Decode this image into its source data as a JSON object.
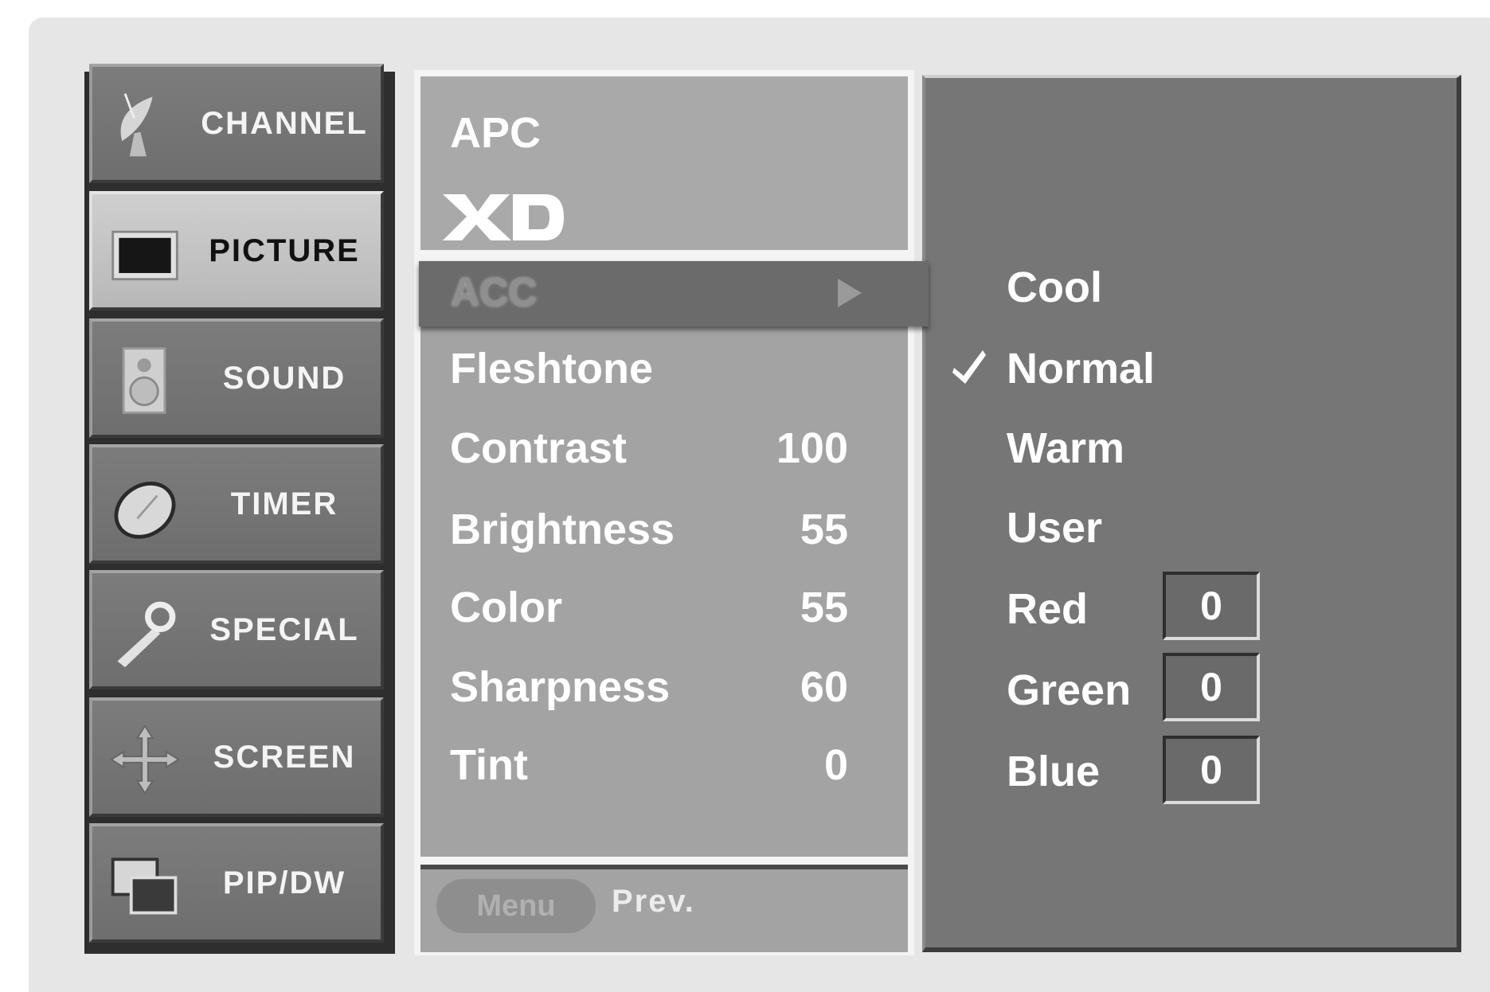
{
  "categories": [
    {
      "label": "CHANNEL",
      "icon": "satellite-dish-icon",
      "active": false
    },
    {
      "label": "PICTURE",
      "icon": "tv-screen-icon",
      "active": true
    },
    {
      "label": "SOUND",
      "icon": "speaker-icon",
      "active": false
    },
    {
      "label": "TIMER",
      "icon": "clock-icon",
      "active": false
    },
    {
      "label": "SPECIAL",
      "icon": "wrench-icon",
      "active": false
    },
    {
      "label": "SCREEN",
      "icon": "move-arrows-icon",
      "active": false
    },
    {
      "label": "PIP/DW",
      "icon": "pip-windows-icon",
      "active": false
    }
  ],
  "picture_menu": {
    "apc_label": "APC",
    "xd_logo": "XD",
    "acc_label": "ACC",
    "options": [
      {
        "name": "Fleshtone",
        "value": ""
      },
      {
        "name": "Contrast",
        "value": "100"
      },
      {
        "name": "Brightness",
        "value": "55"
      },
      {
        "name": "Color",
        "value": "55"
      },
      {
        "name": "Sharpness",
        "value": "60"
      },
      {
        "name": "Tint",
        "value": "0"
      }
    ],
    "footer": {
      "menu_button": "Menu",
      "prev_label": "Prev."
    }
  },
  "color_temperature": {
    "options": [
      "Cool",
      "Normal",
      "Warm",
      "User"
    ],
    "selected": "Normal",
    "user_values": [
      {
        "name": "Red",
        "value": "0"
      },
      {
        "name": "Green",
        "value": "0"
      },
      {
        "name": "Blue",
        "value": "0"
      }
    ]
  },
  "colors": {
    "panel_dark": "#767676",
    "panel_light": "#a3a3a3",
    "highlight_row": "#6b6b6b",
    "active_tab": "#c4c4c4",
    "text": "#ffffff"
  }
}
